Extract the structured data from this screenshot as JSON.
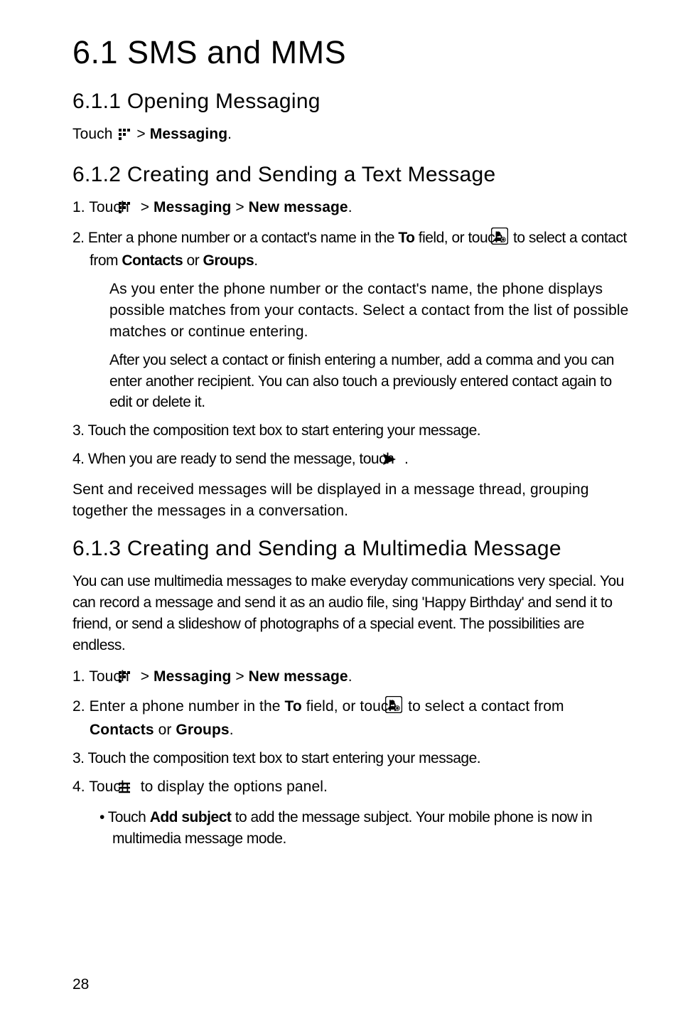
{
  "h1": "6.1  SMS and MMS",
  "s611": {
    "heading": "6.1.1  Opening Messaging",
    "line": {
      "pre": "Touch ",
      "post": "  > ",
      "bold": "Messaging",
      "end": "."
    }
  },
  "s612": {
    "heading": "6.1.2  Creating and Sending a Text Message",
    "step1": {
      "pre": "1. Touch ",
      "mid": "  > ",
      "b1": "Messaging",
      "gt": " > ",
      "b2": "New message",
      "end": "."
    },
    "step2": {
      "pre": "2. Enter a phone number or a contact's name in the ",
      "bold": "To",
      "mid": " field, or touch ",
      "post": " to select a contact from ",
      "b2": "Contacts",
      "or": " or ",
      "b3": "Groups",
      "end": "."
    },
    "note1": "As you enter the phone number or the contact's name, the phone displays possible matches from your contacts. Select a contact from the list of possible matches or continue entering.",
    "note2": "After you select a contact or finish entering a number, add a comma and you can enter another recipient. You can also touch a previously entered contact again to edit or delete it.",
    "step3": "3. Touch the composition text box to start entering your message.",
    "step4": {
      "pre": "4. When you are ready to send the message, touch ",
      "post": " ."
    },
    "para": "Sent and received messages will be displayed in a message thread, grouping together the messages in a conversation."
  },
  "s613": {
    "heading": "6.1.3  Creating and Sending a Multimedia Message",
    "intro": "You can use multimedia messages to make everyday communications very special. You can record a message and send it as an audio file, sing 'Happy Birthday' and send it to friend, or send a slideshow of photographs of a special event. The possibilities are endless.",
    "step1": {
      "pre": "1. Touch ",
      "mid": "  > ",
      "b1": "Messaging",
      "gt": " > ",
      "b2": "New message",
      "end": "."
    },
    "step2": {
      "pre": "2. Enter a phone number in the ",
      "bold": "To",
      "mid": " field, or touch ",
      "post": " to select a contact from ",
      "b2": "Contacts",
      "or": " or ",
      "b3": "Groups",
      "end": "."
    },
    "step3": "3. Touch the composition text box to start entering your message.",
    "step4": {
      "pre": "4. Touch ",
      "post": " to display the options panel."
    },
    "bullet": {
      "pre": "•  Touch ",
      "bold": "Add subject",
      "post": " to add the message subject. Your mobile phone is now in multimedia message mode."
    }
  },
  "pageNumber": "28"
}
